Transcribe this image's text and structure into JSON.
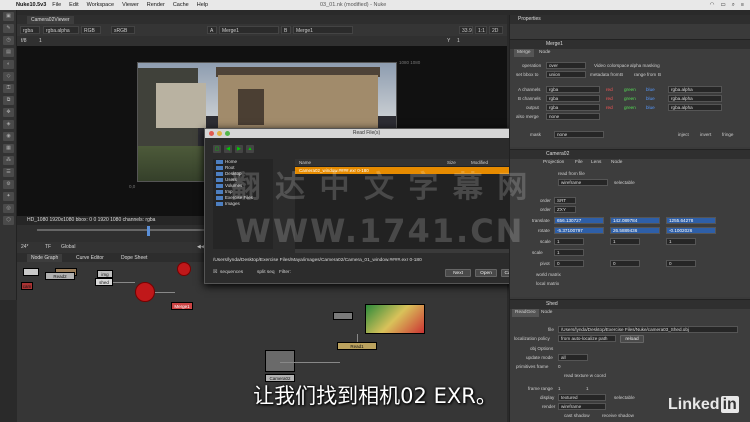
{
  "menubar": {
    "app": "Nuke10.5v3",
    "items": [
      "File",
      "Edit",
      "Workspace",
      "Viewer",
      "Render",
      "Cache",
      "Help"
    ],
    "window_title": "03_01.nk (modified) - Nuke",
    "right": [
      "",
      "",
      "",
      ""
    ]
  },
  "viewer": {
    "tab": "Camera02Viewer",
    "ctrl": [
      "rgba",
      "rgba.alpha",
      "RGB",
      "sRGB",
      "A",
      "Merge1",
      "B",
      "Merge1",
      "33.9",
      "1:1",
      "2D"
    ],
    "frame_ctrl": [
      "f/8",
      "1",
      "Y",
      "1"
    ],
    "corner_label": "1080 1080",
    "origin_label": "0,0",
    "info": "HD_1080 1920x1080  bbox: 0 0 1920 1080 channels: rgba",
    "timeline": [
      "24*",
      "TF",
      "Global"
    ]
  },
  "nodegraph": {
    "tabs": [
      "Node Graph",
      "Curve Editor",
      "Dope Sheet"
    ],
    "nodes": [
      "img",
      "Read2",
      "shed",
      "cam",
      "Merge1",
      "Read1",
      "Camera02"
    ]
  },
  "dialog": {
    "title": "Read File(s)",
    "sidebar": [
      "Home",
      "Root",
      "Desktop",
      "Users",
      "Volumes",
      "tmp",
      "Exercise Files",
      "Images"
    ],
    "columns": [
      "Name",
      "Size",
      "Modified"
    ],
    "selected_file": "Camera02_window.####.exr 0-180",
    "path": "/Users/lynda/Desktop/Exercise Files/Maya/images/Camera02/Camera_01_window.####.exr 0-180",
    "bottom": {
      "sequences": "sequences",
      "split": "split seq",
      "filter": "Filter:"
    },
    "buttons": {
      "next": "Next",
      "open": "Open",
      "cancel": "Cancel"
    }
  },
  "properties": {
    "header": "Properties",
    "merge": {
      "title": "Merge1",
      "tabs": [
        "Merge",
        "Node"
      ],
      "rows": [
        {
          "label": "operation",
          "value": "over"
        },
        {
          "label": "set bbox to",
          "value": "union"
        },
        {
          "label": "A channels",
          "value": "rgba"
        },
        {
          "label": "B channels",
          "value": "rgba"
        },
        {
          "label": "output",
          "value": "rgba"
        },
        {
          "label": "also merge",
          "value": "none"
        },
        {
          "label": "mask",
          "value": "none"
        }
      ],
      "video_colorspace": "Video colorspace",
      "alpha_masking": "alpha masking",
      "metadata_from": "metadata from",
      "range_from": "range from",
      "B": "B",
      "chans": [
        "red",
        "green",
        "blue",
        "rgba.alpha"
      ],
      "inject": "inject",
      "invert": "invert",
      "fringe": "fringe"
    },
    "camera": {
      "title": "Camera02",
      "tabs": [
        "Projection",
        "File",
        "Lens",
        "Node"
      ],
      "read_from_file": "read from file",
      "display": "wireframe",
      "selectable": "selectable",
      "rows": [
        "order",
        "order",
        "translate",
        "rotate",
        "scale",
        "scale",
        "pivot"
      ],
      "order_vals": [
        "SRT",
        "ZXY"
      ],
      "translate": [
        "656.130727",
        "142.089784",
        "1255.64278"
      ],
      "rotate": [
        "-5.37100797",
        "26.5889436",
        "-0.1002026"
      ],
      "scale_vals": [
        "1",
        "1",
        "1"
      ],
      "pivot_vals": [
        "0",
        "0",
        "0"
      ],
      "extra": [
        "world matrix",
        "local matrix"
      ]
    },
    "shed": {
      "title": "Shed",
      "tabs": [
        "ReadGeo",
        "Node"
      ],
      "file": "/Users/lynda/Desktop/Exercise Files/Nuke/camera03_Shed.obj",
      "rows": [
        "file",
        "localization policy",
        "obj Options",
        "update mode",
        "primitives frame",
        "",
        "frame range",
        "display",
        "render"
      ],
      "policy": "from auto-localize path",
      "reload": "reload",
      "update": "all",
      "frame": "0",
      "read_tex": "read texture w coord",
      "frame_range": [
        "1",
        "1"
      ],
      "display": "textured",
      "render": "wireframe",
      "selectable": "selectable",
      "cast": "cast shadow",
      "receive": "receive shadow"
    }
  },
  "subtitle": "让我们找到相机02 EXR。",
  "watermark": {
    "line1": "翻 达 中 文 字 幕 网",
    "line2": "WWW.1741.CN"
  },
  "brand": {
    "linked": "Linked",
    "in": "in"
  },
  "colors": {
    "accent": "#e68b00",
    "selection": "#2e5fa8",
    "node_red": "#c0181a"
  }
}
